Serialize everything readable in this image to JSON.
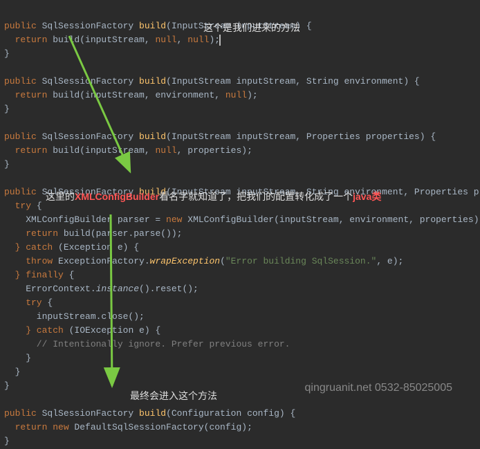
{
  "annotations": {
    "top": "这个是我们进来的方法",
    "middle_prefix": "这里的",
    "middle_bold": "XMLConfigBuilder",
    "middle_suffix": "看名字就知道了，把我们的配置转化成了一个",
    "middle_java": "java类",
    "bottom": "最终会进入这个方法"
  },
  "code": {
    "m1_sig_pre": "public ",
    "m1_sig_type": "SqlSessionFactory ",
    "m1_sig_name": "build",
    "m1_sig_params": "(InputStream inputStream) {",
    "m1_body_ret": "  return ",
    "m1_body_call": "build(inputStream, ",
    "m1_body_null1": "null",
    "m1_body_sep": ", ",
    "m1_body_null2": "null",
    "m1_body_end": ");",
    "close_brace": "}",
    "m2_sig_params": "(InputStream inputStream, String environment) {",
    "m2_body_call": "build(inputStream, environment, ",
    "m2_body_end": ");",
    "m3_sig_params": "(InputStream inputStream, Properties properties) {",
    "m3_body_call": "build(inputStream, ",
    "m3_body_mid": ", properties);",
    "m4_sig_params": "(InputStream inputStream, String environment, Properties properties) {",
    "m4_try": "  try ",
    "m4_try_brace": "{",
    "m4_l1_pre": "    XMLConfigBuilder parser = ",
    "m4_l1_new": "new ",
    "m4_l1_rest": "XMLConfigBuilder(inputStream, environment, properties);",
    "m4_l2_ret": "    return ",
    "m4_l2_rest": "build(parser.parse());",
    "m4_catch": "  } catch ",
    "m4_catch_params": "(Exception e) {",
    "m4_throw": "    throw ",
    "m4_throw_cls": "ExceptionFactory.",
    "m4_throw_method": "wrapException",
    "m4_throw_open": "(",
    "m4_throw_str": "\"Error building SqlSession.\"",
    "m4_throw_end": ", e);",
    "m4_finally": "  } finally ",
    "m4_finally_brace": "{",
    "m4_err": "    ErrorContext.",
    "m4_err_inst": "instance",
    "m4_err_rest": "().reset();",
    "m4_try2": "    try ",
    "m4_try2_brace": "{",
    "m4_close_call": "      inputStream.close();",
    "m4_catch2": "    } catch ",
    "m4_catch2_params": "(IOException e) {",
    "m4_comment": "      // Intentionally ignore. Prefer previous error.",
    "m4_close_inner": "    }",
    "m4_close_finally": "  }",
    "m5_sig_params": "(Configuration config) {",
    "m5_ret": "  return new ",
    "m5_rest": "DefaultSqlSessionFactory(config);"
  },
  "watermark": "qingruanit.net 0532-85025005"
}
